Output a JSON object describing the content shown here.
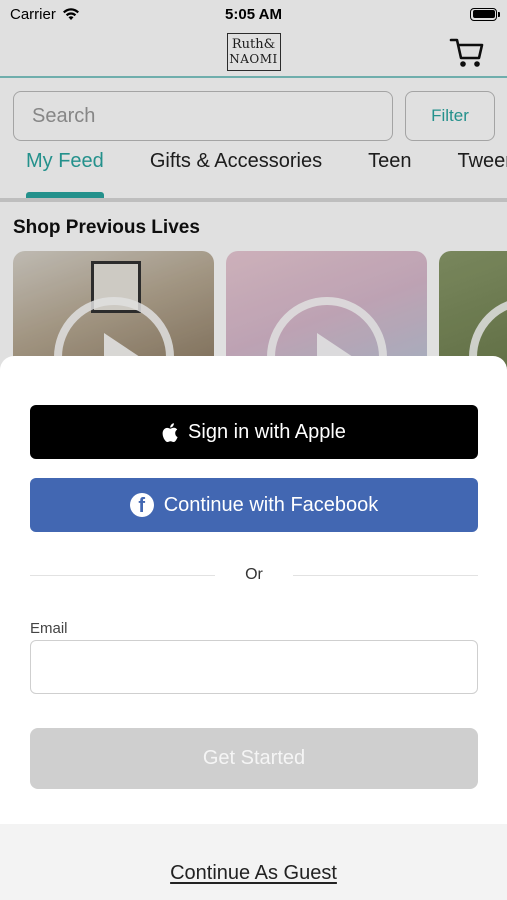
{
  "status_bar": {
    "carrier": "Carrier",
    "time": "5:05 AM"
  },
  "header": {
    "logo_line1": "Ruth&",
    "logo_line2": "NAOMI",
    "cart_icon": "cart-icon"
  },
  "search": {
    "placeholder": "Search",
    "filter_label": "Filter"
  },
  "tabs": [
    {
      "label": "My Feed",
      "active": true
    },
    {
      "label": "Gifts & Accessories",
      "active": false
    },
    {
      "label": "Teen",
      "active": false
    },
    {
      "label": "Tween",
      "active": false
    }
  ],
  "section": {
    "title": "Shop Previous Lives"
  },
  "sheet": {
    "apple_label": "Sign in with Apple",
    "facebook_label": "Continue with Facebook",
    "or_label": "Or",
    "email_label": "Email",
    "email_value": "",
    "get_started_label": "Get Started",
    "guest_label": "Continue As Guest"
  },
  "colors": {
    "accent": "#2aa6a0",
    "facebook": "#4267b2",
    "apple": "#000000",
    "disabled_button": "#cfcfcf"
  }
}
